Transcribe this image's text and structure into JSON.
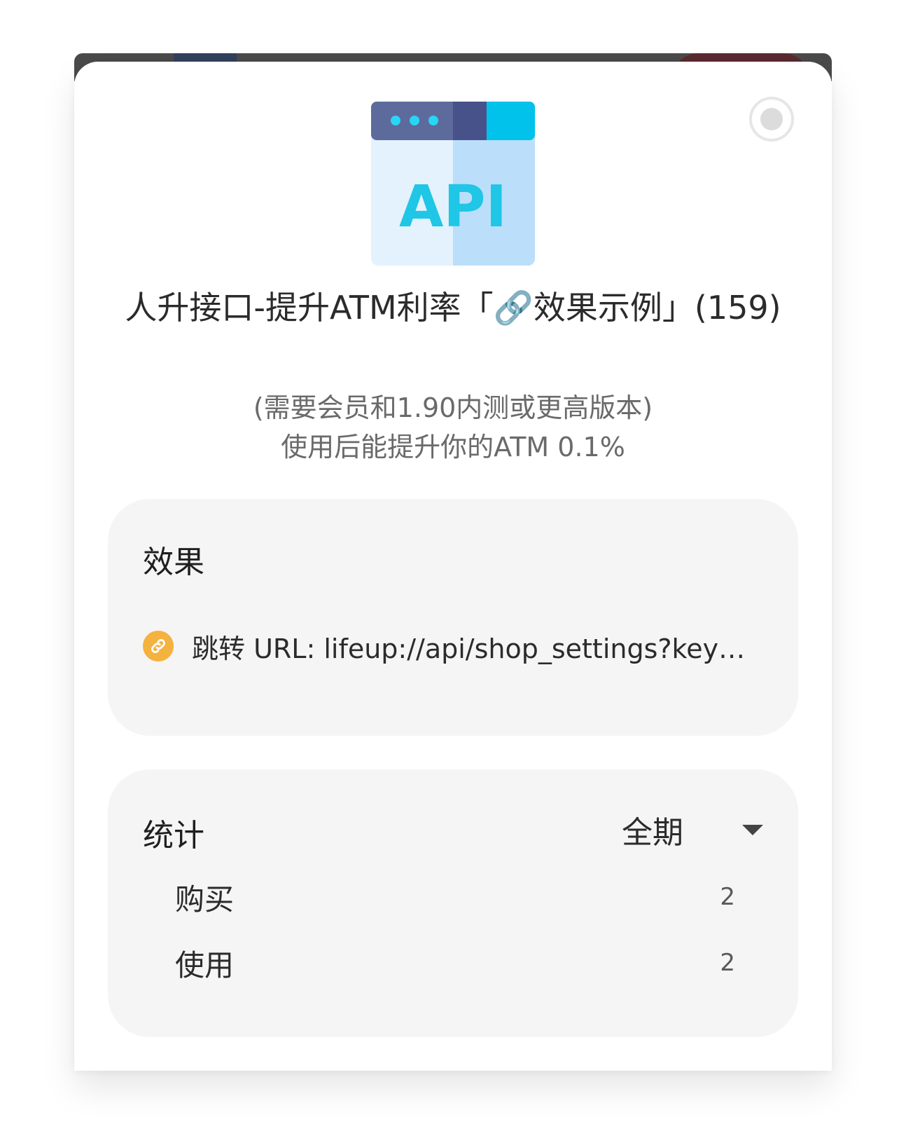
{
  "dialog": {
    "title": "人升接口-提升ATM利率「🔗效果示例」(159)",
    "subtitle_line1": "(需要会员和1.90内测或更高版本)",
    "subtitle_line2": "使用后能提升你的ATM 0.1%",
    "icon_text": "API"
  },
  "effect": {
    "heading": "效果",
    "link_text": "跳转 URL: lifeup://api/shop_settings?key=…"
  },
  "stats": {
    "heading": "统计",
    "period": "全期",
    "rows": [
      {
        "label": "购买",
        "value": "2"
      },
      {
        "label": "使用",
        "value": "2"
      }
    ]
  },
  "colors": {
    "card_background": "#f5f5f5",
    "link_icon": "#f4b23e",
    "api_text": "#1fc6e6"
  },
  "icons": [
    "api-icon",
    "link-icon",
    "close-icon",
    "dropdown-caret-icon"
  ]
}
